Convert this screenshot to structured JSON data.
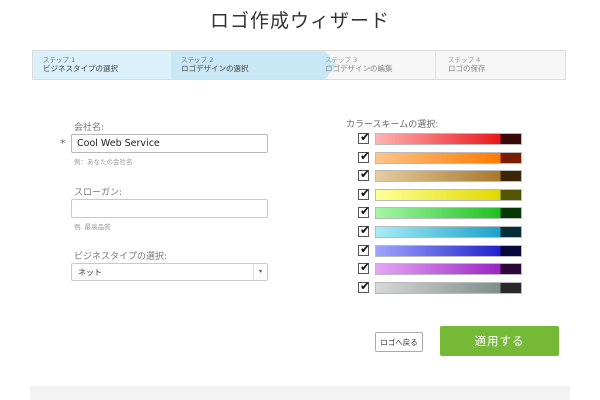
{
  "header": {
    "title": "ロゴ作成ウィザード"
  },
  "steps": [
    {
      "num": "ステップ 1",
      "label": "ビジネスタイプの選択"
    },
    {
      "num": "ステップ 2",
      "label": "ロゴデザインの選択"
    },
    {
      "num": "ステップ 3",
      "label": "ロゴデザインの編集"
    },
    {
      "num": "ステップ 4",
      "label": "ロゴの保存"
    }
  ],
  "form": {
    "company": {
      "label": "会社名:",
      "required_mark": "*",
      "value": "Cool Web Service",
      "hint": "例：あなたの会社名"
    },
    "slogan": {
      "label": "スローガン:",
      "value": "",
      "hint": "例. 最高品質"
    },
    "business_type": {
      "label": "ビジネスタイプの選択:",
      "value": "ネット",
      "caret": "▾"
    }
  },
  "color_schemes": {
    "title": "カラースキームの選択:",
    "check_glyph": "✔",
    "items": [
      {
        "name": "red",
        "checked": true,
        "from": "#ffb3b3",
        "to": "#e8161b",
        "dark": "#3a0a0a"
      },
      {
        "name": "orange",
        "checked": true,
        "from": "#ffc48a",
        "to": "#ff7a00",
        "dark": "#7a1c00"
      },
      {
        "name": "brown",
        "checked": true,
        "from": "#e6cca0",
        "to": "#a8782c",
        "dark": "#3a2606"
      },
      {
        "name": "yellow",
        "checked": true,
        "from": "#ffff99",
        "to": "#e0d800",
        "dark": "#555500"
      },
      {
        "name": "green",
        "checked": true,
        "from": "#a6f7a6",
        "to": "#1fbf22",
        "dark": "#063806"
      },
      {
        "name": "cyan",
        "checked": true,
        "from": "#a8ecf7",
        "to": "#1aa2c8",
        "dark": "#062e3a"
      },
      {
        "name": "blue",
        "checked": true,
        "from": "#9ea6ff",
        "to": "#2022c9",
        "dark": "#08083a"
      },
      {
        "name": "purple",
        "checked": true,
        "from": "#e6a6f4",
        "to": "#9a25c4",
        "dark": "#2e063a"
      },
      {
        "name": "gray",
        "checked": true,
        "from": "#d8d8d8",
        "to": "#7d8f8a",
        "dark": "#2a2a2a"
      }
    ]
  },
  "actions": {
    "back_label": "ロゴへ戻る",
    "apply_label": "適用する"
  }
}
